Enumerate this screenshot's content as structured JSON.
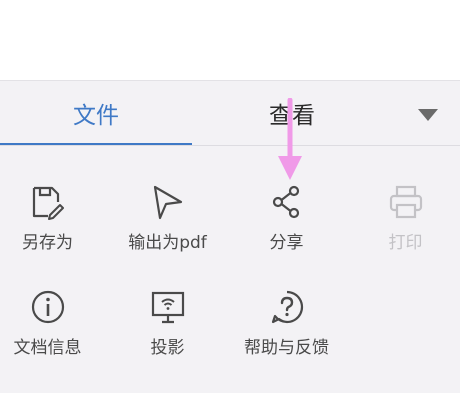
{
  "tabs": [
    {
      "label": "文件",
      "active": true
    },
    {
      "label": "查看",
      "active": false
    }
  ],
  "menu": [
    {
      "label": "另存为",
      "icon": "save-as-icon",
      "enabled": true
    },
    {
      "label": "输出为pdf",
      "icon": "export-pdf-icon",
      "enabled": true
    },
    {
      "label": "分享",
      "icon": "share-icon",
      "enabled": true
    },
    {
      "label": "打印",
      "icon": "print-icon",
      "enabled": false
    },
    {
      "label": "文档信息",
      "icon": "info-icon",
      "enabled": true
    },
    {
      "label": "投影",
      "icon": "projection-icon",
      "enabled": true
    },
    {
      "label": "帮助与反馈",
      "icon": "help-icon",
      "enabled": true
    }
  ],
  "colors": {
    "accent": "#3f79c6",
    "icon": "#4a4a4a",
    "disabled": "#c3c2c6",
    "sheet_bg": "#f3f2f5",
    "annotation_arrow": "#f09ae8"
  }
}
